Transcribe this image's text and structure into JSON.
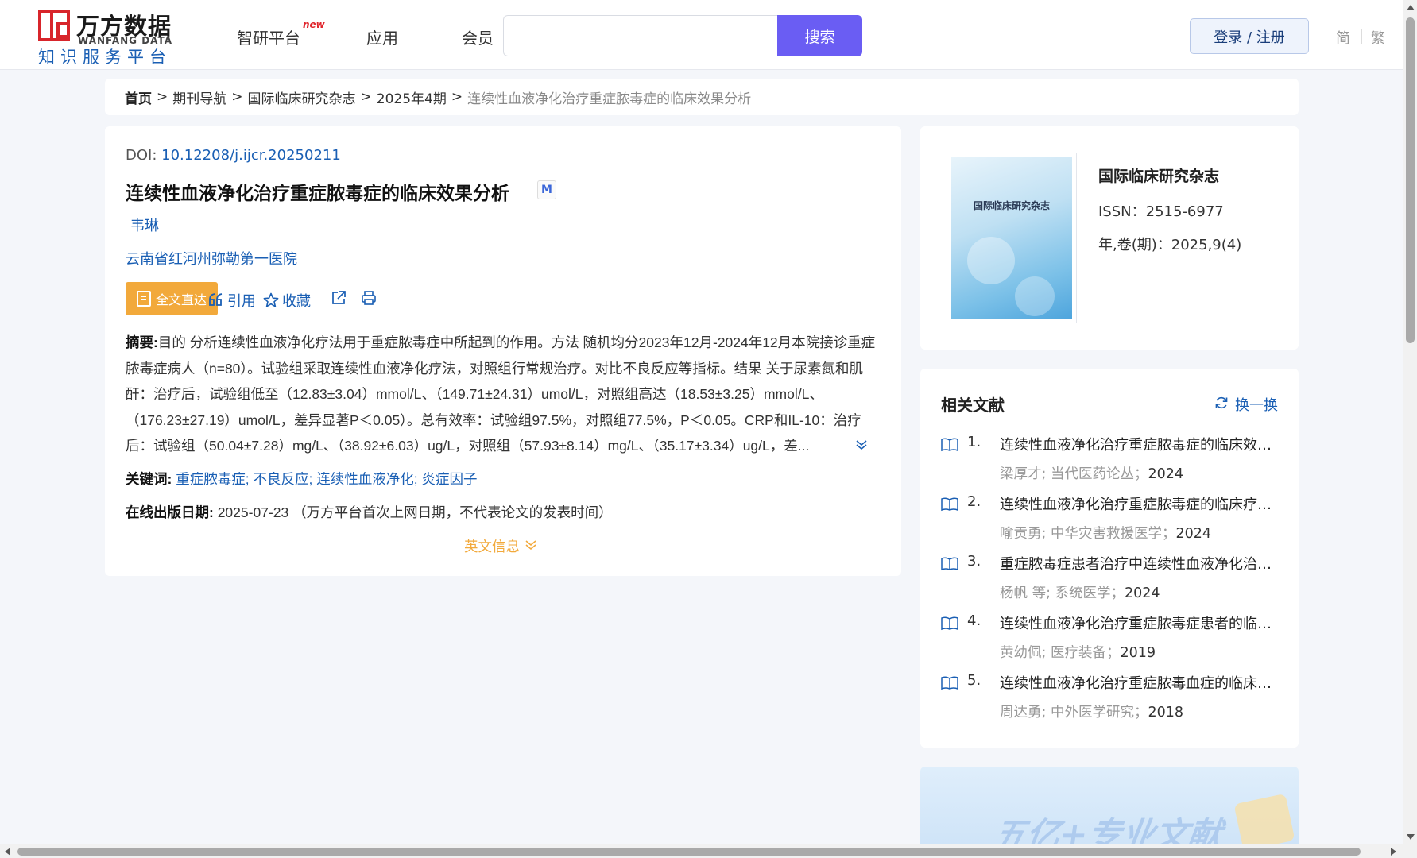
{
  "header": {
    "logo_cn": "万方数据",
    "logo_en": "WANFANG DATA",
    "logo_sub": "知识服务平台",
    "nav": [
      "智研平台",
      "应用",
      "会员"
    ],
    "nav_badge": "new",
    "search_placeholder": "",
    "search_button": "搜索",
    "login": "登录 / 注册",
    "lang_simplified": "简",
    "lang_traditional": "繁"
  },
  "breadcrumb": {
    "home": "首页",
    "sep": ">",
    "items": [
      "期刊导航",
      "国际临床研究杂志",
      "2025年4期"
    ],
    "current": "连续性血液净化治疗重症脓毒症的临床效果分析"
  },
  "article": {
    "doi_label": "DOI:",
    "doi": "10.12208/j.ijcr.20250211",
    "title": "连续性血液净化治疗重症脓毒症的临床效果分析",
    "m_icon": "M",
    "author": "韦琳",
    "org": "云南省红河州弥勒第一医院",
    "actions": {
      "fulltext": "全文直达",
      "cite": "引用",
      "collect": "收藏"
    },
    "abstract_label": "摘要:",
    "abstract": "目的 分析连续性血液净化疗法用于重症脓毒症中所起到的作用。方法 随机均分2023年12月-2024年12月本院接诊重症脓毒症病人（n=80）。试验组采取连续性血液净化疗法，对照组行常规治疗。对比不良反应等指标。结果 关于尿素氮和肌酐：治疗后，试验组低至（12.83±3.04）mmol/L、（149.71±24.31）umol/L，对照组高达（18.53±3.25）mmol/L、（176.23±27.19）umol/L，差异显著P＜0.05）。总有效率：试验组97.5%，对照组77.5%，P＜0.05。CRP和IL-10：治疗后：试验组（50.04±7.28）mg/L、（38.92±6.03）ug/L，对照组（57.93±8.14）mg/L、（35.17±3.34）ug/L，差...",
    "keywords_label": "关键词:",
    "keywords": [
      "重症脓毒症",
      "不良反应",
      "连续性血液净化",
      "炎症因子"
    ],
    "online_date_label": "在线出版日期:",
    "online_date": "2025-07-23",
    "online_date_note": "（万方平台首次上网日期，不代表论文的发表时间）",
    "en_info": "英文信息"
  },
  "journal": {
    "cover_title": "国际临床研究杂志",
    "name": "国际临床研究杂志",
    "issn": "ISSN：2515-6977",
    "volume": "年,卷(期)：2025,9(4)"
  },
  "related": {
    "title": "相关文献",
    "refresh": "换一换",
    "items": [
      {
        "num": "1.",
        "title": "连续性血液净化治疗重症脓毒症的临床效果分析",
        "meta": "梁厚才; 当代医药论丛；",
        "year": "2024"
      },
      {
        "num": "2.",
        "title": "连续性血液净化治疗重症脓毒症的临床疗效观察",
        "meta": "喻贡勇; 中华灾害救援医学；",
        "year": "2024"
      },
      {
        "num": "3.",
        "title": "重症脓毒症患者治疗中连续性血液净化治疗的效果",
        "meta": "杨帆  等;  系统医学；",
        "year": "2024"
      },
      {
        "num": "4.",
        "title": "连续性血液净化治疗重症脓毒症患者的临床效果分析",
        "meta": "黄幼佩; 医疗装备；",
        "year": "2019"
      },
      {
        "num": "5.",
        "title": "连续性血液净化治疗重症脓毒血症的临床效果",
        "meta": "周达勇; 中外医学研究；",
        "year": "2018"
      }
    ]
  },
  "banner": {
    "text": "五亿+专业文献"
  },
  "colors": {
    "brand_red": "#d8252b",
    "link_blue": "#1a5fb4",
    "search_purple": "#6a5df3",
    "accent_orange": "#f2a93b"
  }
}
